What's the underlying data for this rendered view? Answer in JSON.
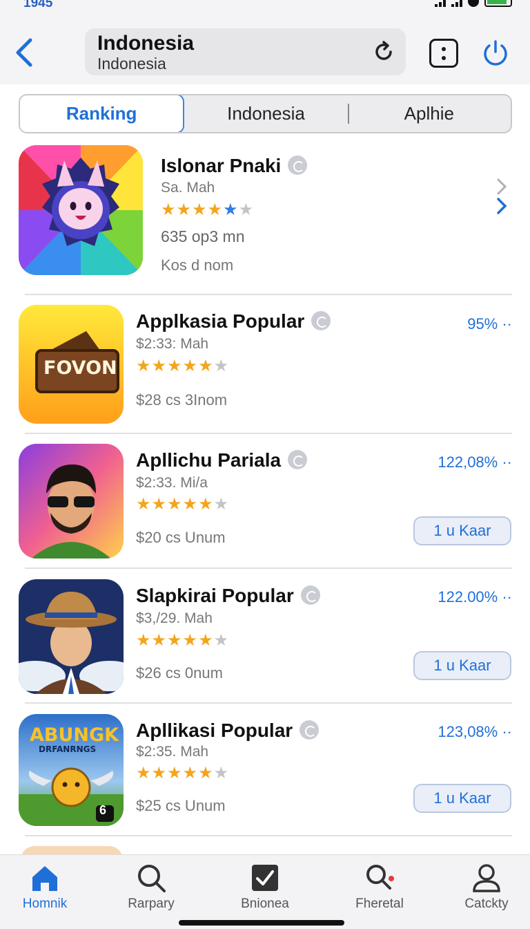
{
  "status": {
    "time": "1945"
  },
  "header": {
    "title": "Indonesia",
    "subtitle": "Indonesia"
  },
  "segments": [
    "Ranking",
    "Indonesia",
    "Aplhie"
  ],
  "apps": [
    {
      "title": "Islonar Pnaki",
      "sub": "Sa. Mah",
      "stars": 4.5,
      "meta1": "635 op3 mn",
      "meta2": "Kos d nom",
      "pct": "",
      "button": ""
    },
    {
      "title": "Applkasia Popular",
      "sub": "$2:33: Mah",
      "stars": 4,
      "meta1": "",
      "meta2": "$28 cs 3Inom",
      "pct": "95% ··",
      "button": ""
    },
    {
      "title": "Apllichu Pariala",
      "sub": "$2:33. Mi/a",
      "stars": 4,
      "meta1": "",
      "meta2": "$20 cs Unum",
      "pct": "122,08% ··",
      "button": "1 u Kaar"
    },
    {
      "title": "Slapkirai Popular",
      "sub": "$3,/29. Mah",
      "stars": 4,
      "meta1": "",
      "meta2": "$26 cs 0num",
      "pct": "122.00% ··",
      "button": "1 u Kaar"
    },
    {
      "title": "Apllikasi Popular",
      "sub": "$2:35. Mah",
      "stars": 4,
      "meta1": "",
      "meta2": "$25 cs Unum",
      "pct": "123,08% ··",
      "button": "1 u Kaar"
    }
  ],
  "icon_text": {
    "fovon": "FOVON",
    "abungk": "ABUNGK",
    "abungk_sub": "DRFANRNGS",
    "badge": "6"
  },
  "tabs": [
    {
      "label": "Homnik",
      "icon": "home-icon"
    },
    {
      "label": "Rarpary",
      "icon": "search-icon"
    },
    {
      "label": "Bnionea",
      "icon": "checkbox-icon"
    },
    {
      "label": "Fheretal",
      "icon": "magnifier-dot-icon"
    },
    {
      "label": "Catckty",
      "icon": "person-icon"
    }
  ],
  "colors": {
    "accent": "#1f6fd8",
    "star": "#f2a51d",
    "background": "#ffffff"
  }
}
